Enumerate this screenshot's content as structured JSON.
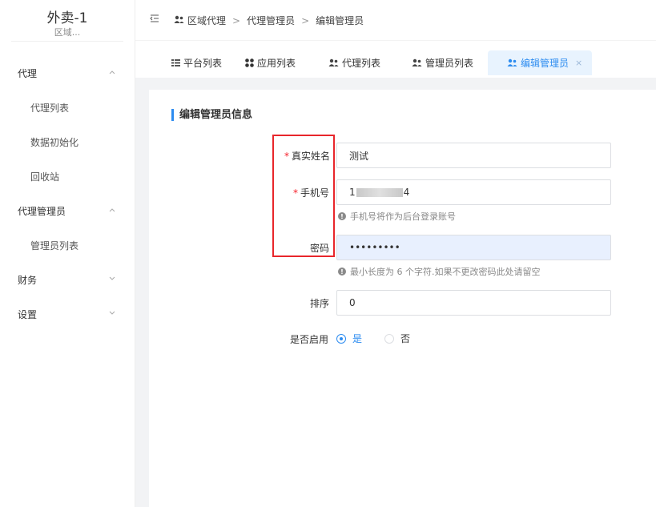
{
  "sidebar": {
    "brand_title": "外卖-1",
    "brand_sub": "区域...",
    "items": [
      {
        "label": "代理",
        "type": "group",
        "expanded": true
      },
      {
        "label": "代理列表",
        "type": "sub"
      },
      {
        "label": "数据初始化",
        "type": "sub"
      },
      {
        "label": "回收站",
        "type": "sub"
      },
      {
        "label": "代理管理员",
        "type": "group",
        "expanded": true
      },
      {
        "label": "管理员列表",
        "type": "sub"
      },
      {
        "label": "财务",
        "type": "group",
        "expanded": false
      },
      {
        "label": "设置",
        "type": "group",
        "expanded": false
      }
    ]
  },
  "breadcrumb": {
    "items": [
      "区域代理",
      "代理管理员",
      "编辑管理员"
    ],
    "separator": ">"
  },
  "tabs": [
    {
      "label": "平台列表",
      "icon": "grid-list-icon"
    },
    {
      "label": "应用列表",
      "icon": "apps-icon"
    },
    {
      "label": "代理列表",
      "icon": "users-icon"
    },
    {
      "label": "管理员列表",
      "icon": "users-icon"
    },
    {
      "label": "编辑管理员",
      "icon": "users-icon",
      "active": true,
      "close": "×"
    }
  ],
  "form": {
    "section_title": "编辑管理员信息",
    "name_label": "真实姓名",
    "name_value": "测试",
    "phone_label": "手机号",
    "phone_prefix": "1",
    "phone_suffix": "4",
    "phone_hint": "手机号将作为后台登录账号",
    "password_label": "密码",
    "password_value": "•••••••••",
    "password_hint": "最小长度为 6 个字符.如果不更改密码此处请留空",
    "sort_label": "排序",
    "sort_value": "0",
    "enabled_label": "是否启用",
    "enabled_yes": "是",
    "enabled_no": "否",
    "required_mark": "*",
    "hint_icon_glyph": "!"
  },
  "colors": {
    "accent": "#2d8cf0",
    "required": "#f5222d",
    "highlight": "#e8262b",
    "content_bg": "#f2f3f5"
  }
}
